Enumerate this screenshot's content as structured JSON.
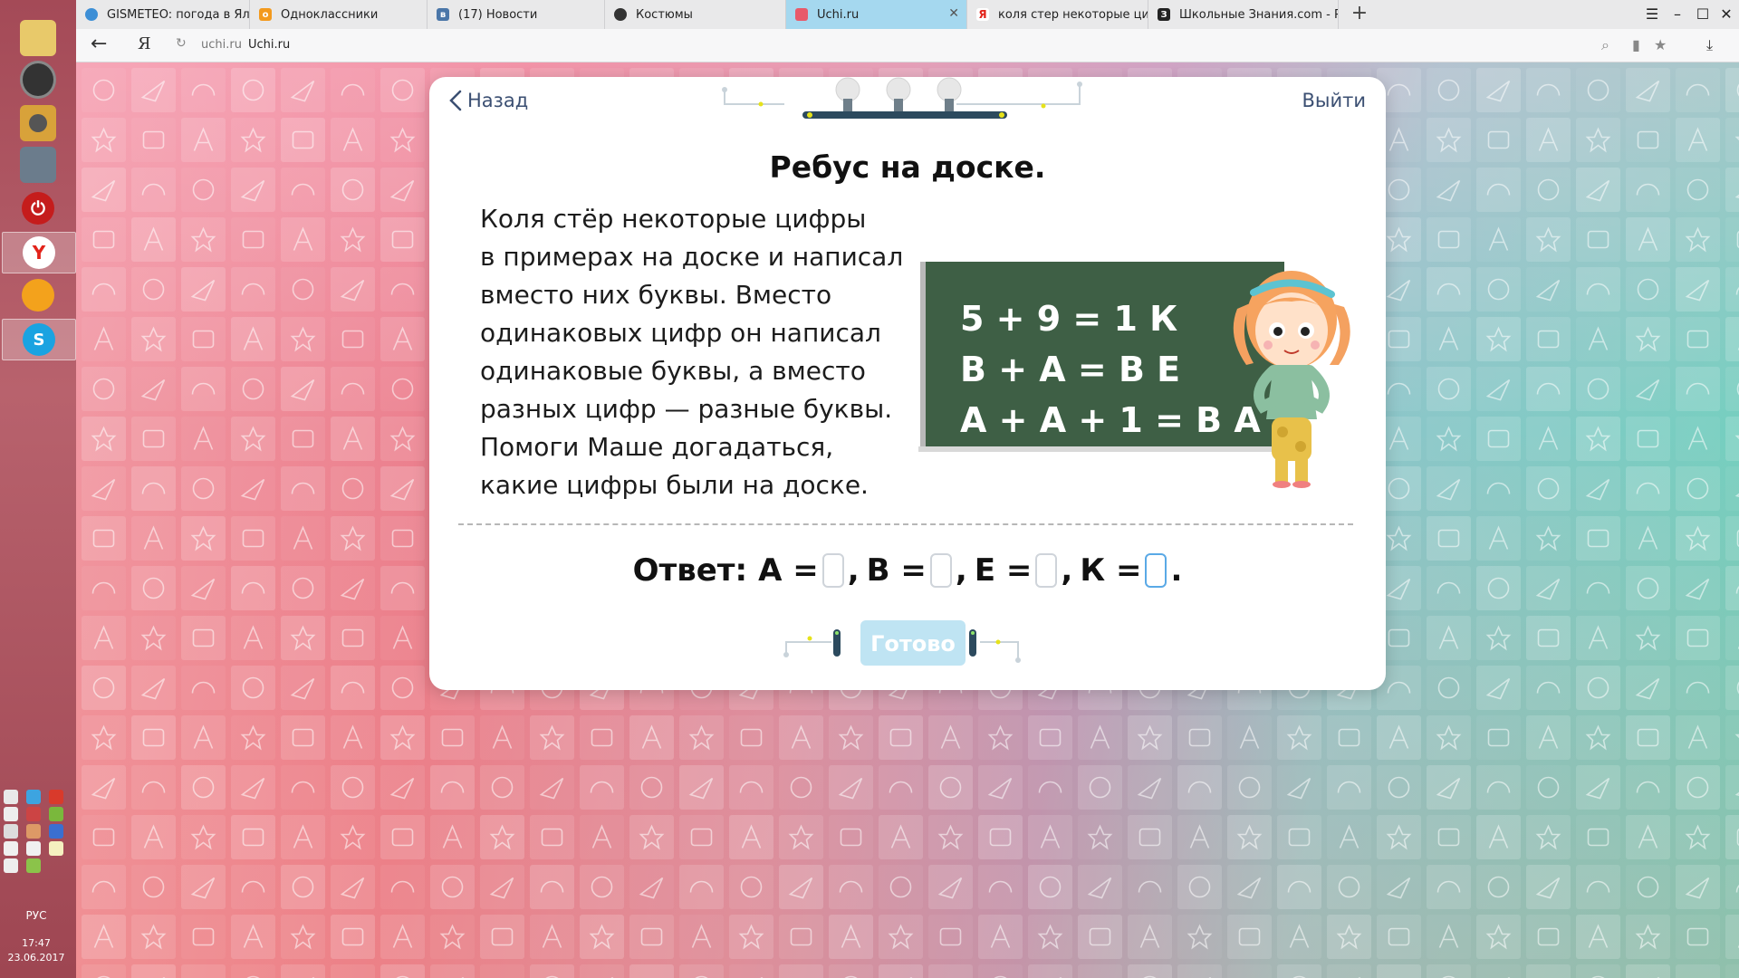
{
  "os": {
    "taskbar_apps": [
      "folder-icon",
      "speaker-icon",
      "webcam-icon",
      "photo-viewer-icon",
      "power-icon",
      "yandex-browser-icon",
      "media-icon",
      "skype-icon"
    ],
    "lang": "РУС",
    "clock_time": "17:47",
    "clock_date": "23.06.2017"
  },
  "browser": {
    "tabs": [
      {
        "label": "GISMETEO: погода в Ялутор",
        "favicon": "#3d8fd6"
      },
      {
        "label": "Одноклассники",
        "favicon": "#f39a1e"
      },
      {
        "label": "(17) Новости",
        "favicon": "#4a76a8"
      },
      {
        "label": "Костюмы",
        "favicon": "#333333"
      },
      {
        "label": "Uchi.ru",
        "favicon": "#e85a6a",
        "active": true
      },
      {
        "label": "коля стер некоторые цифр",
        "favicon": "#ffffff"
      },
      {
        "label": "Школьные Знания.com - Ре",
        "favicon": "#222222"
      }
    ],
    "address": {
      "host": "uchi.ru",
      "title": "Uchi.ru",
      "logo": "Я"
    }
  },
  "task": {
    "back_label": "Назад",
    "exit_label": "Выйти",
    "title": "Ребус на доске.",
    "text_lines": [
      "Коля стёр некоторые цифры",
      "в примерах на доске и написал",
      "вместо них буквы. Вместо",
      "одинаковых цифр он написал",
      "одинаковые буквы, а вместо",
      "разных цифр — разные буквы.",
      "Помоги Маше догадаться,",
      "какие цифры были на доске."
    ],
    "board_lines": [
      "5 + 9 = 1 К",
      "В + А = В Е",
      "А + А + 1 = В А"
    ],
    "answer": {
      "label": "Ответ:",
      "vars": [
        {
          "name": "А =",
          "sep": ","
        },
        {
          "name": "В =",
          "sep": ","
        },
        {
          "name": "Е =",
          "sep": ","
        },
        {
          "name": "К =",
          "sep": "."
        }
      ]
    },
    "done_label": "Готово"
  },
  "colors": {
    "accent_blue": "#5aa9e6",
    "link": "#3b4f72",
    "board": "#3e5f45",
    "done_button": "#bfe4f3",
    "active_tab": "#a5d8ef"
  }
}
